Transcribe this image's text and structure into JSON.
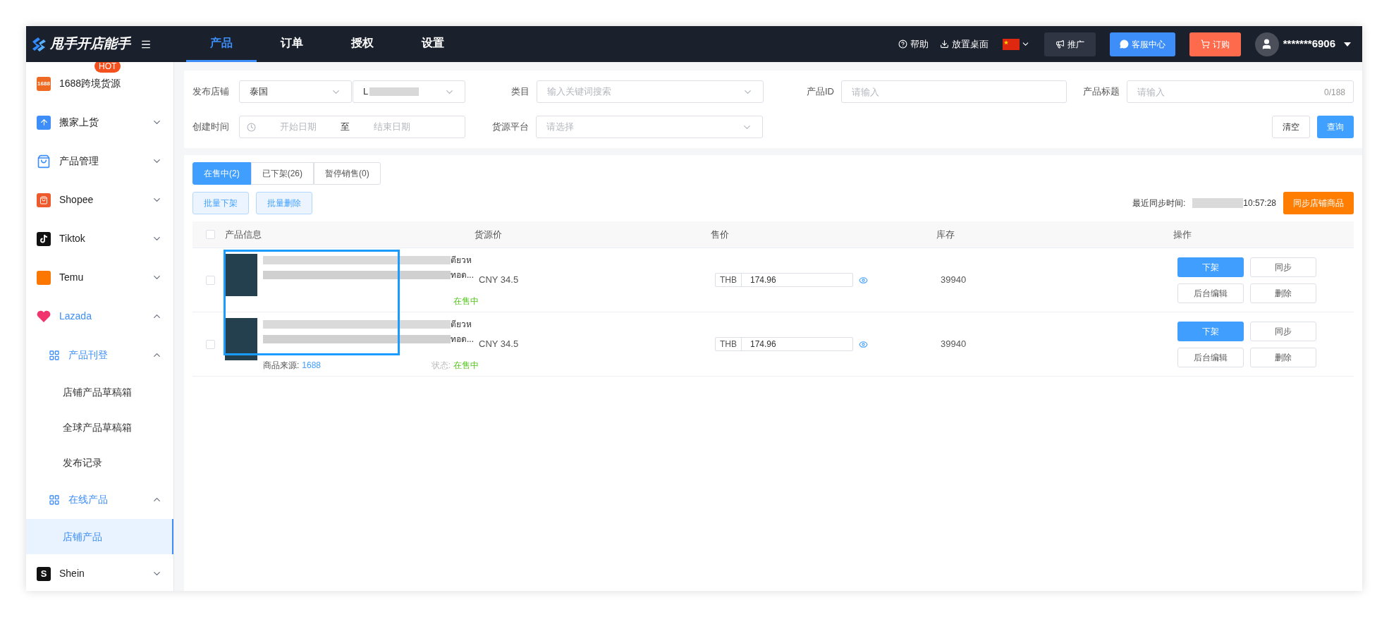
{
  "header": {
    "logo": "甩手开店能手",
    "nav": [
      {
        "label": "产品",
        "selected": true
      },
      {
        "label": "订单",
        "selected": false
      },
      {
        "label": "授权",
        "selected": false
      },
      {
        "label": "设置",
        "selected": false
      }
    ],
    "help": "帮助",
    "desktop": "放置桌面",
    "promote": "推广",
    "service": "客服中心",
    "order": "订购",
    "user": "*******6906"
  },
  "sidebar": [
    {
      "label": "1688跨境货源",
      "icon_text": "1688",
      "badge": "HOT"
    },
    {
      "label": "搬家上货",
      "expanded": false
    },
    {
      "label": "产品管理",
      "expanded": false
    },
    {
      "label": "Shopee",
      "expanded": false
    },
    {
      "label": "Tiktok",
      "expanded": false
    },
    {
      "label": "Temu",
      "expanded": false
    },
    {
      "label": "Lazada",
      "expanded": true,
      "children": [
        {
          "label": "产品刊登",
          "expanded": true,
          "children": [
            {
              "label": "店铺产品草稿箱",
              "selected": false
            },
            {
              "label": "全球产品草稿箱",
              "selected": false
            },
            {
              "label": "发布记录",
              "selected": false
            }
          ]
        },
        {
          "label": "在线产品",
          "expanded": true,
          "children": [
            {
              "label": "店铺产品",
              "selected": true
            }
          ]
        }
      ]
    },
    {
      "label": "Shein",
      "icon_text": "S",
      "expanded": false
    }
  ],
  "filters": {
    "store_label": "发布店铺",
    "store_value": "泰国",
    "account_value": "L",
    "category_label": "类目",
    "category_placeholder": "输入关键词搜索",
    "id_label": "产品ID",
    "id_placeholder": "请输入",
    "title_label": "产品标题",
    "title_placeholder": "请输入",
    "title_count": "0/188",
    "time_label": "创建时间",
    "start_placeholder": "开始日期",
    "to": "至",
    "end_placeholder": "结束日期",
    "source_label": "货源平台",
    "source_placeholder": "请选择",
    "clear": "清空",
    "search": "查询"
  },
  "tabs": [
    {
      "label": "在售中(2)",
      "selected": true
    },
    {
      "label": "已下架(26)",
      "selected": false
    },
    {
      "label": "暂停销售(0)",
      "selected": false
    }
  ],
  "bulk": [
    "批量下架",
    "批量删除"
  ],
  "sync_label": "最近同步时间:",
  "sync_time": "10:57:28",
  "sync_button": "同步店铺商品",
  "table": {
    "select_all_checked": false,
    "columns": [
      "产品信息",
      "货源价",
      "售价",
      "库存",
      "操作"
    ],
    "rows": [
      {
        "checked": false,
        "title_fragments": [
          "ตียวห",
          "ทอด..."
        ],
        "status": "在售中",
        "cost": "CNY 34.5",
        "currency": "THB",
        "price": "174.96",
        "stock": "39940",
        "actions": [
          "下架",
          "同步",
          "后台编辑",
          "删除"
        ]
      },
      {
        "checked": false,
        "title_fragments": [
          "ตียวห",
          "ทอด..."
        ],
        "source_label": "商品来源:",
        "source": "1688",
        "status_label": "状态:",
        "status": "在售中",
        "cost": "CNY 34.5",
        "currency": "THB",
        "price": "174.96",
        "stock": "39940",
        "actions": [
          "下架",
          "同步",
          "后台编辑",
          "删除"
        ]
      }
    ]
  }
}
